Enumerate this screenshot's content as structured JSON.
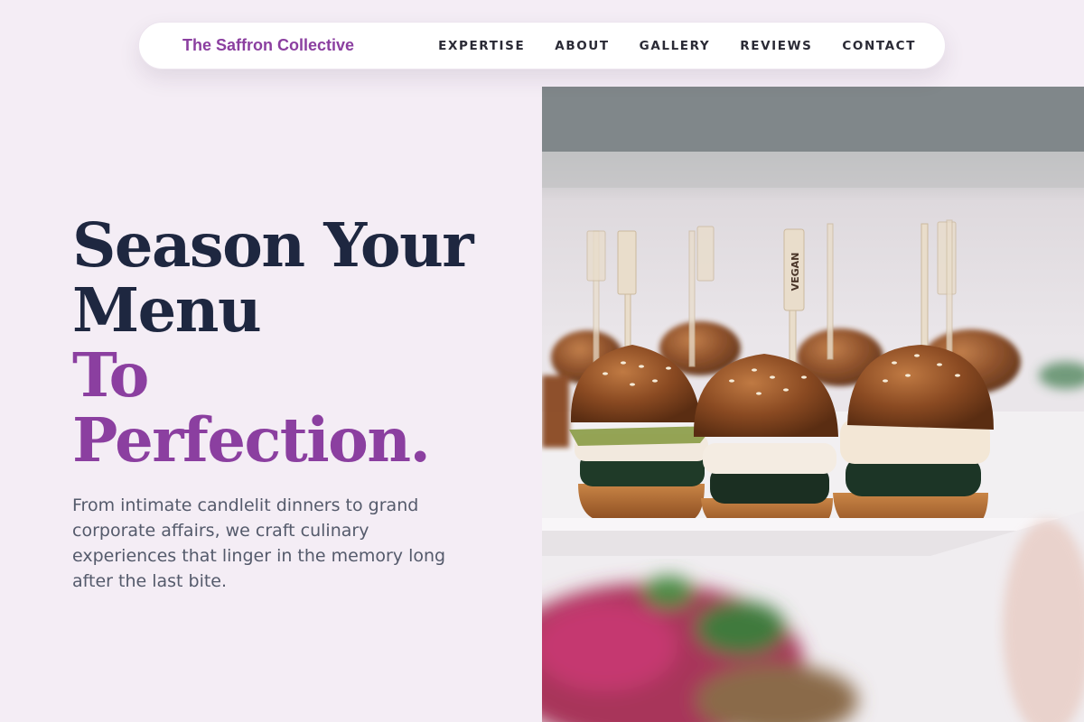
{
  "nav": {
    "brand": "The Saffron Collective",
    "links": [
      "EXPERTISE",
      "ABOUT",
      "GALLERY",
      "REVIEWS",
      "CONTACT"
    ]
  },
  "hero": {
    "title_lines": [
      "Season Your",
      "Menu"
    ],
    "title_accent_lines": [
      "To",
      "Perfection."
    ],
    "description": "From intimate candlelit dinners to grand corporate affairs, we craft culinary experiences that linger in the memory long after the last bite.",
    "image_alt": "Platter of mini burger sliders on skewers"
  },
  "photo": {
    "skewer_tag": "VEGAN"
  },
  "colors": {
    "background": "#f4edf5",
    "accent": "#8b3fa0",
    "heading": "#1e2740",
    "body_text": "#545a6b"
  }
}
